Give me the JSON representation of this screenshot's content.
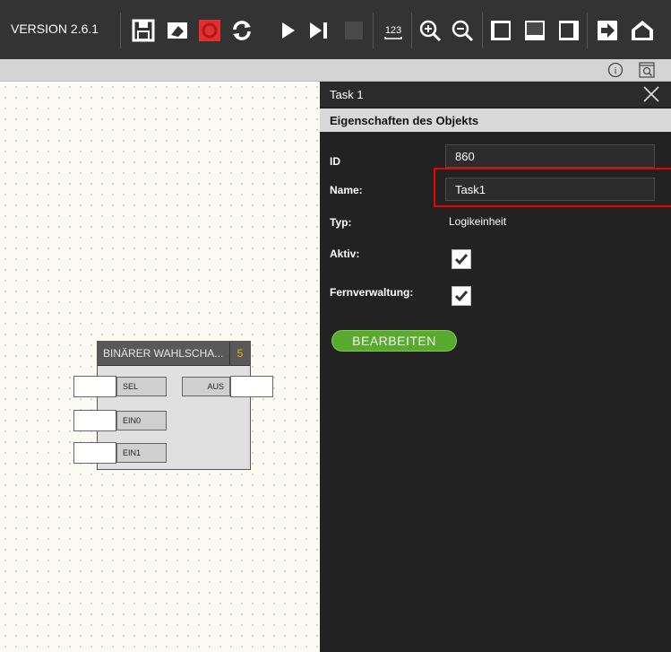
{
  "toolbar": {
    "version": "VERSION 2.6.1",
    "buttons": [
      "save-icon",
      "eraser-icon",
      "refresh-red-icon",
      "sync-icon",
      "play-icon",
      "step-icon",
      "stop-icon",
      "numbers-icon",
      "zoom-in-icon",
      "zoom-out-icon",
      "panel-left-icon",
      "panel-bottom-icon",
      "panel-right-icon",
      "export-icon",
      "home-icon"
    ],
    "numbers_label": "123",
    "accent_color": "#e03030"
  },
  "subbar": {
    "icons": [
      "info-icon",
      "search-page-icon"
    ]
  },
  "block": {
    "title": "BINÄRER WAHLSCHA...",
    "number": "5",
    "inputs": [
      "SEL",
      "EIN0",
      "EIN1"
    ],
    "output": "AUS"
  },
  "panel": {
    "title": "Task 1",
    "section": "Eigenschaften des Objekts",
    "labels": {
      "id": "ID",
      "name": "Name:",
      "type": "Typ:",
      "active": "Aktiv:",
      "remote": "Fernverwaltung:"
    },
    "values": {
      "id": "860",
      "name": "Task1",
      "type": "Logikeinheit",
      "active": true,
      "remote": true
    },
    "edit_button": "BEARBEITEN",
    "button_color": "#5aaa2f"
  }
}
